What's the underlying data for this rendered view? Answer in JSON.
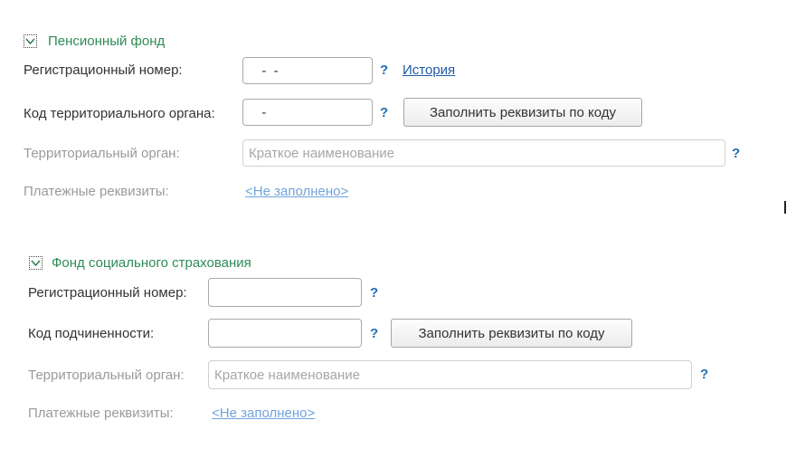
{
  "pension": {
    "title": "Пенсионный фонд",
    "reg_number_label": "Регистрационный номер:",
    "reg_number_value": "  -  -",
    "history_link": "История",
    "territorial_code_label": "Код территориального органа:",
    "territorial_code_value": "  -",
    "fill_button": "Заполнить реквизиты по коду",
    "territorial_body_label": "Территориальный орган:",
    "territorial_body_placeholder": "Краткое наименование",
    "payment_details_label": "Платежные реквизиты:",
    "payment_details_link": "<Не заполнено>",
    "help": "?"
  },
  "social": {
    "title": "Фонд социального страхования",
    "reg_number_label": "Регистрационный номер:",
    "reg_number_value": "",
    "subordination_code_label": "Код подчиненности:",
    "subordination_code_value": "",
    "fill_button": "Заполнить реквизиты по коду",
    "territorial_body_label": "Территориальный орган:",
    "territorial_body_placeholder": "Краткое наименование",
    "payment_details_label": "Платежные реквизиты:",
    "payment_details_link": "<Не заполнено>",
    "help": "?"
  }
}
